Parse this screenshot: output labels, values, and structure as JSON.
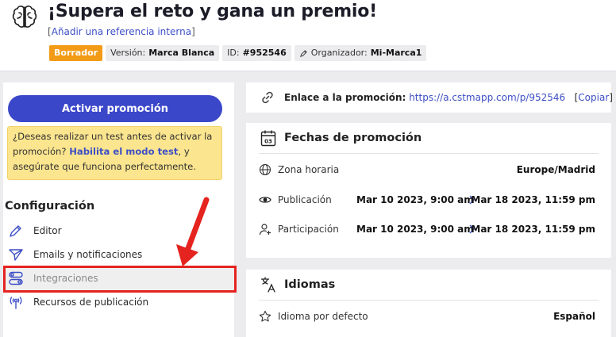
{
  "header": {
    "title": "¡Supera el reto y gana un premio!",
    "ref_open": "[",
    "ref_link": "Añadir una referencia interna",
    "ref_close": "]",
    "badge_status": "Borrador",
    "version_label": "Versión:",
    "version_value": "Marca Blanca",
    "id_label": "ID:",
    "id_value": "#952546",
    "organizer_label": "Organizador:",
    "organizer_value": "Mi-Marca1"
  },
  "left": {
    "activate_label": "Activar promoción",
    "test_text_1": "¿Deseas realizar un test antes de activar la promoción?",
    "test_link": "Habilita el modo test",
    "test_text_2": ", y asegúrate que funciona perfectamente.",
    "config_title": "Configuración",
    "menu": [
      {
        "label": "Editor",
        "icon": "pencil-icon"
      },
      {
        "label": "Emails y notificaciones",
        "icon": "paper-plane-icon"
      },
      {
        "label": "Integraciones",
        "icon": "toggles-icon"
      },
      {
        "label": "Recursos de publicación",
        "icon": "broadcast-icon"
      }
    ]
  },
  "link_card": {
    "label": "Enlace a la promoción:",
    "url": "https://a.cstmapp.com/p/952546",
    "copy_open": "[",
    "copy_label": "Copiar",
    "copy_close": "]"
  },
  "dates_card": {
    "title": "Fechas de promoción",
    "calendar_day": "03",
    "timezone_label": "Zona horaria",
    "timezone_value": "Europe/Madrid",
    "publication_label": "Publicación",
    "publication_start": "Mar 10 2023, 9:00 am",
    "publication_end": "Mar 18 2023, 11:59 pm",
    "participation_label": "Participación",
    "participation_start": "Mar 10 2023, 9:00 am",
    "participation_end": "Mar 18 2023, 11:59 pm"
  },
  "lang_card": {
    "title": "Idiomas",
    "default_label": "Idioma por defecto",
    "default_value": "Español"
  },
  "colors": {
    "accent": "#3b47c9",
    "draft": "#f39b17",
    "warning_bg": "#fbe58e",
    "annotation_red": "#e5231f"
  }
}
